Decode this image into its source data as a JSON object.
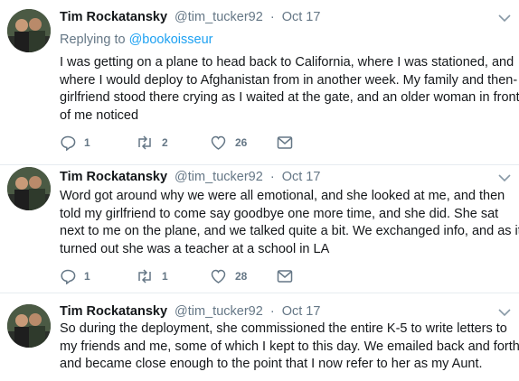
{
  "colors": {
    "accent": "#1da1f2",
    "secondary_text": "#657786",
    "divider": "#e6ecf0"
  },
  "tweets": [
    {
      "name": "Tim Rockatansky",
      "handle": "@tim_tucker92",
      "separator": "·",
      "date": "Oct 17",
      "replying_prefix": "Replying to",
      "replying_handle": "@bookoisseur",
      "lines": [
        "I was getting on a plane to head back to California, where I was stationed, and",
        "where I would deploy to Afghanistan from in another week. My family and then-",
        "girlfriend stood there crying as I waited at the gate, and an older woman in front",
        "of me noticed"
      ],
      "replies": "1",
      "retweets": "2",
      "likes": "26"
    },
    {
      "name": "Tim Rockatansky",
      "handle": "@tim_tucker92",
      "separator": "·",
      "date": "Oct 17",
      "lines": [
        "Word got around why we were all emotional, and she looked at me, and then",
        "told my girlfriend to come say goodbye one more time, and she did. She sat",
        "next to me on the plane, and we talked quite a bit. We exchanged info, and as it",
        "turned out she was a teacher at a school in LA"
      ],
      "replies": "1",
      "retweets": "1",
      "likes": "28"
    },
    {
      "name": "Tim Rockatansky",
      "handle": "@tim_tucker92",
      "separator": "·",
      "date": "Oct 17",
      "lines": [
        "So during the deployment, she commissioned the entire K-5 to write letters to",
        "my friends and me, some of which I kept to this day. We emailed back and forth",
        "and became close enough to the point that I now refer to her as my Aunt."
      ]
    }
  ]
}
